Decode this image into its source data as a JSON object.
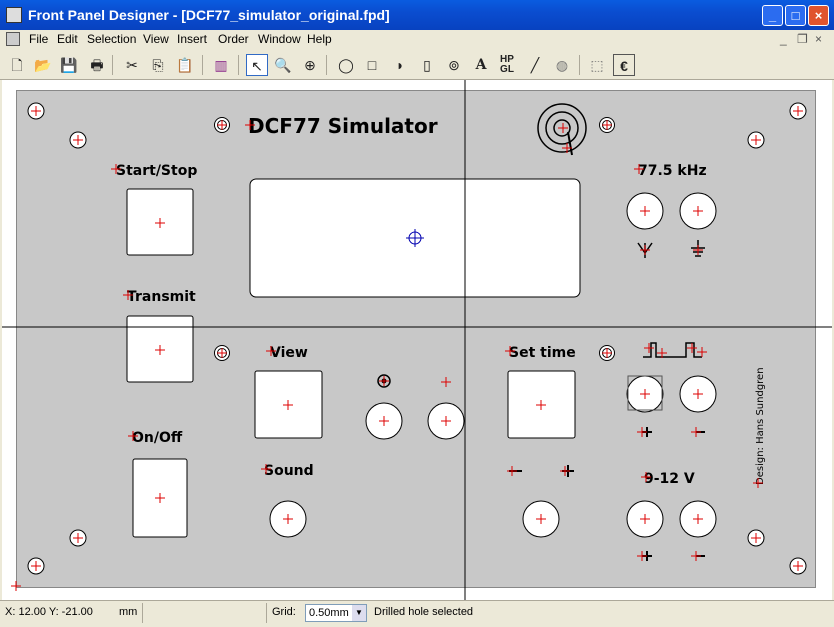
{
  "window": {
    "title": "Front Panel Designer - [DCF77_simulator_original.fpd]"
  },
  "menu": [
    "File",
    "Edit",
    "Selection",
    "View",
    "Insert",
    "Order",
    "Window",
    "Help"
  ],
  "toolbar": {
    "text_tool": "A",
    "hpgl_top": "HP",
    "hpgl_bottom": "GL",
    "euro": "€"
  },
  "panel": {
    "title": "DCF77 Simulator",
    "label_start_stop": "Start/Stop",
    "label_transmit": "Transmit",
    "label_on_off": "On/Off",
    "label_view": "View",
    "label_sound": "Sound",
    "label_set_time": "Set time",
    "label_freq": "77.5 kHz",
    "label_voltage": "9-12 V",
    "label_design": "Design: Hans Sundgren"
  },
  "status": {
    "coords": "X: 12.00  Y: -21.00",
    "units": "mm",
    "grid_label": "Grid:",
    "grid_value": "0.50mm",
    "message": "Drilled hole selected"
  }
}
